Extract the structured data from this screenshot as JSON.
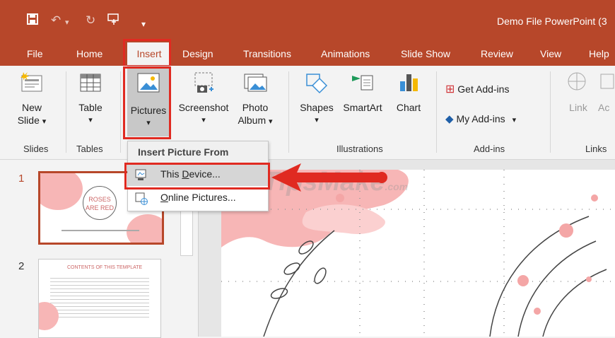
{
  "titlebar": {
    "window_title": "Demo File PowerPoint (3",
    "quick_access": [
      "save-icon",
      "undo-icon",
      "redo-icon",
      "touch-mode-icon",
      "customize-icon"
    ]
  },
  "tabs": [
    {
      "label": "File"
    },
    {
      "label": "Home"
    },
    {
      "label": "Insert"
    },
    {
      "label": "Design"
    },
    {
      "label": "Transitions"
    },
    {
      "label": "Animations"
    },
    {
      "label": "Slide Show"
    },
    {
      "label": "Review"
    },
    {
      "label": "View"
    },
    {
      "label": "Help"
    }
  ],
  "ribbon": {
    "new_slide": {
      "line1": "New",
      "line2": "Slide",
      "arrow": "▾"
    },
    "table": {
      "label": "Table",
      "arrow": "▾"
    },
    "pictures": {
      "label": "Pictures",
      "arrow": "▾"
    },
    "screenshot": {
      "label": "Screenshot",
      "arrow": "▾"
    },
    "photo_album": {
      "line1": "Photo",
      "line2": "Album",
      "arrow": "▾"
    },
    "shapes": {
      "label": "Shapes",
      "arrow": "▾"
    },
    "smartart": {
      "label": "SmartArt"
    },
    "chart": {
      "label": "Chart"
    },
    "get_addins": {
      "label": "Get Add-ins"
    },
    "my_addins": {
      "label": "My Add-ins",
      "arrow": "▾"
    },
    "link": {
      "label": "Link"
    },
    "action": {
      "label": "Ac"
    },
    "groups": {
      "slides": "Slides",
      "tables": "Tables",
      "illustrations": "Illustrations",
      "addins": "Add-ins",
      "links": "Links"
    }
  },
  "dropdown": {
    "header": "Insert Picture From",
    "items": [
      {
        "label_pre": "This ",
        "label_u": "D",
        "label_post": "evice..."
      },
      {
        "label_pre": "",
        "label_u": "O",
        "label_post": "nline Pictures..."
      }
    ]
  },
  "thumbnails": [
    {
      "number": "1",
      "title_line1": "ROSES",
      "title_line2": "ARE RED"
    },
    {
      "number": "2",
      "title_line1": "CONTENTS OF THIS TEMPLATE"
    }
  ],
  "watermark": {
    "text": "TipsMake",
    ".com": ".com"
  },
  "colors": {
    "accent": "#b7472a",
    "highlight": "#e02a21",
    "slide_pink": "#f7b6b6"
  }
}
